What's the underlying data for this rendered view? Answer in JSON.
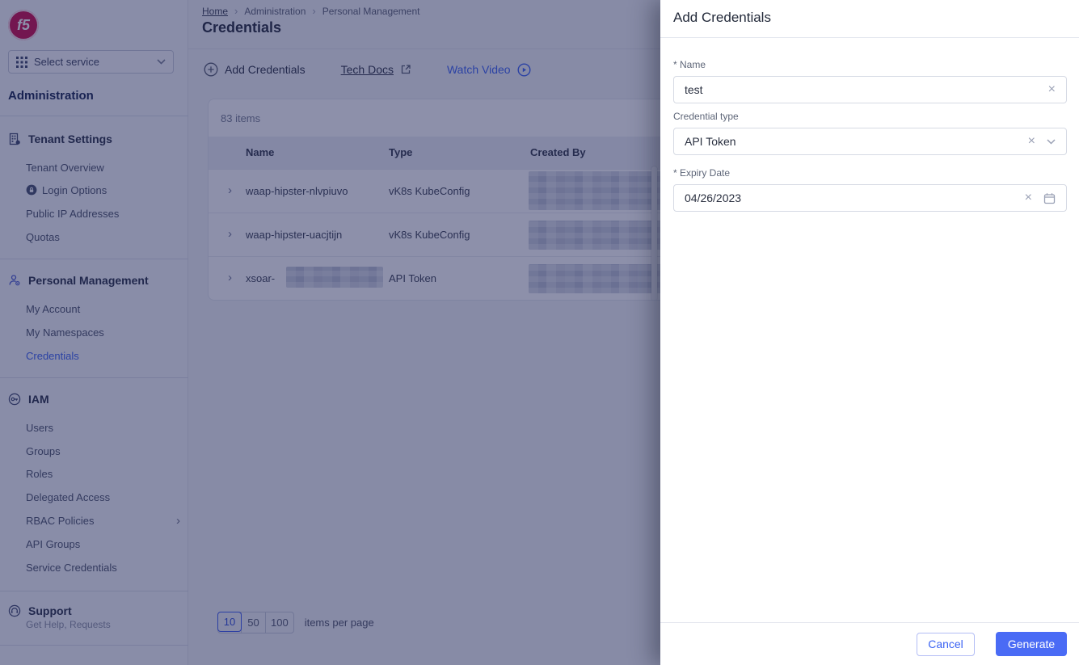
{
  "colors": {
    "accent_blue": "#3B63F3",
    "primary_button": "#4A6BF5",
    "brand_red": "#CA0B4A",
    "scrim": "rgba(28,34,86,0.5)"
  },
  "glyphs": {
    "chevron_right": "›",
    "clear": "×",
    "breadcrumb_separator": "›"
  },
  "sidebar": {
    "logo": "f5",
    "service_selector": "Select service",
    "title": "Administration",
    "sections": [
      {
        "label": "Tenant Settings",
        "items": [
          {
            "label": "Tenant Overview"
          },
          {
            "label": "Login Options"
          },
          {
            "label": "Public IP Addresses"
          },
          {
            "label": "Quotas"
          }
        ]
      },
      {
        "label": "Personal Management",
        "items": [
          {
            "label": "My Account"
          },
          {
            "label": "My Namespaces"
          },
          {
            "label": "Credentials",
            "active": true
          }
        ]
      },
      {
        "label": "IAM",
        "items": [
          {
            "label": "Users"
          },
          {
            "label": "Groups"
          },
          {
            "label": "Roles"
          },
          {
            "label": "Delegated Access"
          },
          {
            "label": "RBAC Policies",
            "has_submenu": true
          },
          {
            "label": "API Groups"
          },
          {
            "label": "Service Credentials"
          }
        ]
      }
    ],
    "support": {
      "label": "Support",
      "subtitle": "Get Help, Requests"
    }
  },
  "breadcrumb": {
    "items": [
      "Home",
      "Administration",
      "Personal Management"
    ]
  },
  "page": {
    "title": "Credentials"
  },
  "toolbar": {
    "add": "Add Credentials",
    "tech_docs": "Tech Docs",
    "watch_video": "Watch Video"
  },
  "table": {
    "count_label": "83 items",
    "columns": {
      "name": "Name",
      "type": "Type",
      "created_by": "Created By"
    },
    "rows": [
      {
        "name": "waap-hipster-nlvpiuvo",
        "type": "vK8s KubeConfig",
        "created_by_redacted": true
      },
      {
        "name": "waap-hipster-uacjtijn",
        "type": "vK8s KubeConfig",
        "created_by_redacted": true
      },
      {
        "name": "xsoar-",
        "name_redacted": true,
        "type": "API Token",
        "created_by_redacted": true
      }
    ]
  },
  "pagination": {
    "options": [
      "10",
      "50",
      "100"
    ],
    "selected": "10",
    "label": "items per page"
  },
  "panel": {
    "title": "Add Credentials",
    "fields": {
      "name": {
        "label": "* Name",
        "value": "test"
      },
      "credential_type": {
        "label": "Credential type",
        "value": "API Token"
      },
      "expiry": {
        "label": "* Expiry Date",
        "value": "04/26/2023"
      }
    },
    "actions": {
      "cancel": "Cancel",
      "generate": "Generate"
    }
  },
  "icons": [
    "f5-logo",
    "grid-icon",
    "chevron-down-icon",
    "building-icon",
    "lock-circle-icon",
    "person-gear-icon",
    "key-icon",
    "headset-icon",
    "plus-circle-icon",
    "external-link-icon",
    "play-circle-icon",
    "clear-icon",
    "calendar-icon",
    "chevron-right-icon"
  ]
}
